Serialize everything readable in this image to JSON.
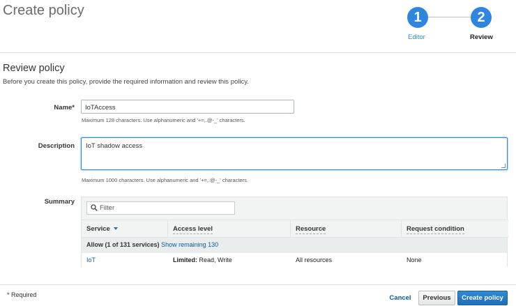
{
  "page": {
    "title": "Create policy"
  },
  "stepper": {
    "steps": [
      {
        "number": "1",
        "label": "Editor"
      },
      {
        "number": "2",
        "label": "Review"
      }
    ],
    "colors": {
      "active": "#2e86de",
      "completed_label": "#2e86de"
    }
  },
  "review": {
    "title": "Review policy",
    "description": "Before you create this policy, provide the required information and review this policy."
  },
  "form": {
    "name": {
      "label": "Name*",
      "value": "IoTAccess",
      "hint": "Maximum 128 characters. Use alphanumeric and '+=,.@-_' characters."
    },
    "description": {
      "label": "Description",
      "value": "IoT shadow access",
      "hint": "Maximum 1000 characters. Use alphanumeric and '+=,.@-_' characters."
    },
    "summary": {
      "label": "Summary"
    }
  },
  "summary_table": {
    "filter_placeholder": "Filter",
    "columns": [
      "Service",
      "Access level",
      "Resource",
      "Request condition"
    ],
    "group": {
      "label": "Allow (1 of 131 services)",
      "link": "Show remaining 130"
    },
    "rows": [
      {
        "service": "IoT",
        "access_prefix": "Limited:",
        "access_rest": " Read, Write",
        "resource": "All resources",
        "condition": "None"
      }
    ]
  },
  "footer": {
    "required_note": "* Required",
    "cancel_label": "Cancel",
    "previous_label": "Previous",
    "create_label": "Create policy"
  }
}
